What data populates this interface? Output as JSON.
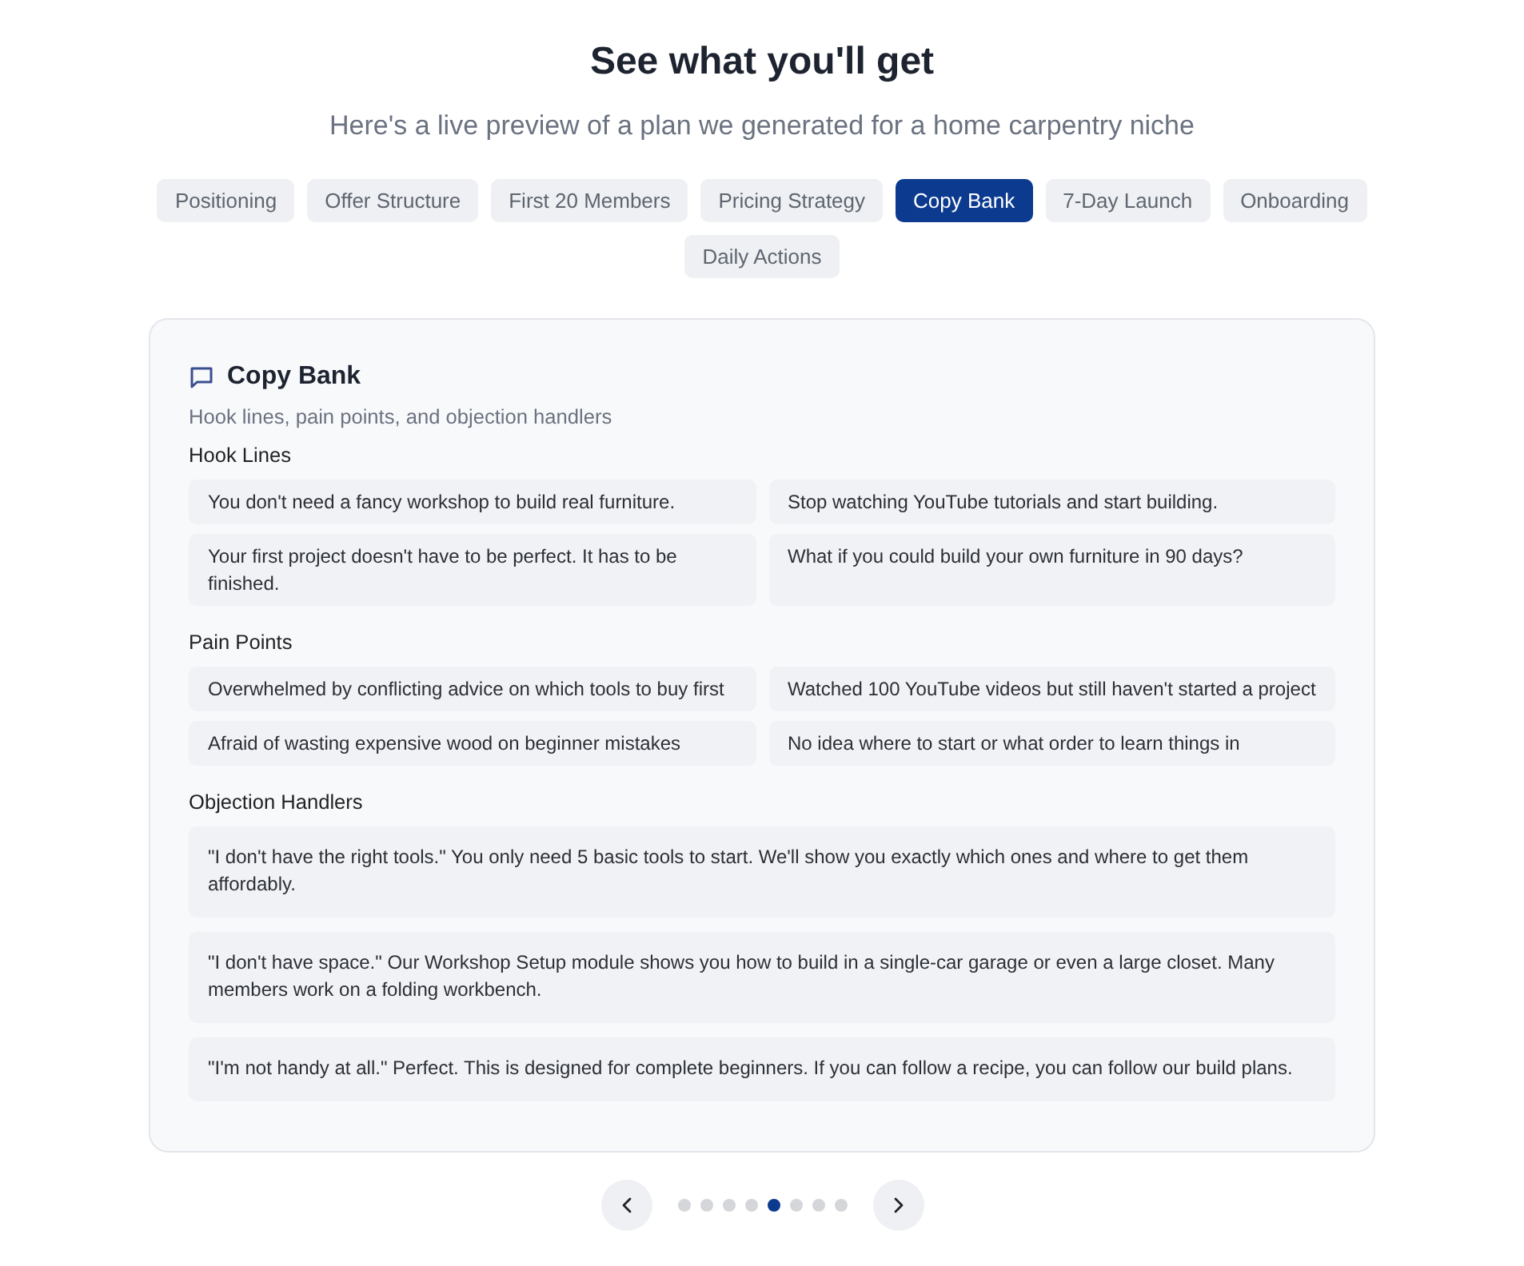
{
  "header": {
    "title": "See what you'll get",
    "subtitle": "Here's a live preview of a plan we generated for a home carpentry niche"
  },
  "tabs": [
    {
      "label": "Positioning",
      "selected": false
    },
    {
      "label": "Offer Structure",
      "selected": false
    },
    {
      "label": "First 20 Members",
      "selected": false
    },
    {
      "label": "Pricing Strategy",
      "selected": false
    },
    {
      "label": "Copy Bank",
      "selected": true
    },
    {
      "label": "7-Day Launch",
      "selected": false
    },
    {
      "label": "Onboarding",
      "selected": false
    },
    {
      "label": "Daily Actions",
      "selected": false
    }
  ],
  "panel": {
    "title": "Copy Bank",
    "subtitle": "Hook lines, pain points, and objection handlers",
    "sections": [
      {
        "heading": "Hook Lines",
        "kind": "grid",
        "items": [
          "You don't need a fancy workshop to build real furniture.",
          "Stop watching YouTube tutorials and start building.",
          "Your first project doesn't have to be perfect. It has to be finished.",
          "What if you could build your own furniture in 90 days?"
        ]
      },
      {
        "heading": "Pain Points",
        "kind": "grid",
        "items": [
          "Overwhelmed by conflicting advice on which tools to buy first",
          "Watched 100 YouTube videos but still haven't started a project",
          "Afraid of wasting expensive wood on beginner mistakes",
          "No idea where to start or what order to learn things in"
        ]
      },
      {
        "heading": "Objection Handlers",
        "kind": "stack",
        "items": [
          "\"I don't have the right tools.\" You only need 5 basic tools to start. We'll show you exactly which ones and where to get them affordably.",
          "\"I don't have space.\" Our Workshop Setup module shows you how to build in a single-car garage or even a large closet. Many members work on a folding workbench.",
          "\"I'm not handy at all.\" Perfect. This is designed for complete beginners. If you can follow a recipe, you can follow our build plans."
        ]
      }
    ]
  },
  "pager": {
    "dots": [
      {
        "selected": false
      },
      {
        "selected": false
      },
      {
        "selected": false
      },
      {
        "selected": false
      },
      {
        "selected": true
      },
      {
        "selected": false
      },
      {
        "selected": false
      },
      {
        "selected": false
      }
    ]
  }
}
